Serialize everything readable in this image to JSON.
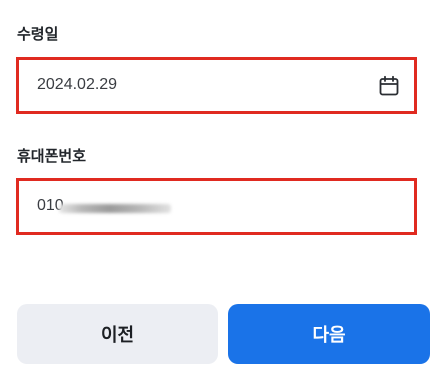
{
  "receipt_date": {
    "label": "수령일",
    "value": "2024.02.29",
    "icon": "calendar-icon"
  },
  "phone": {
    "label": "휴대폰번호",
    "value": "010"
  },
  "buttons": {
    "prev_label": "이전",
    "next_label": "다음"
  },
  "colors": {
    "highlight_border": "#e02a20",
    "primary": "#1a73e8",
    "secondary": "#eceef3"
  }
}
